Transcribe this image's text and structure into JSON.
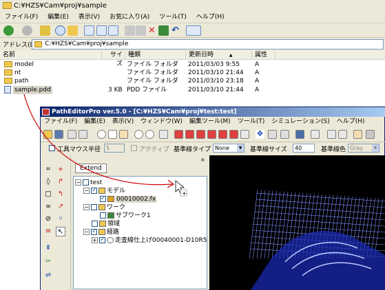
{
  "explorer": {
    "title": "C:¥HZS¥Cam¥proj¥sample",
    "menu": [
      "ファイル(F)",
      "編集(E)",
      "表示(V)",
      "お気に入り(A)",
      "ツール(T)",
      "ヘルプ(H)"
    ],
    "address_label": "アドレス(D)",
    "address_value": "C:¥HZS¥Cam¥proj¥sample",
    "columns": {
      "name": "名前",
      "size": "サイズ",
      "type": "種類",
      "date": "更新日時",
      "sort": "▲",
      "attr": "属性"
    },
    "rows": [
      {
        "name": "model",
        "size": "",
        "type": "ファイル フォルダ",
        "date": "2011/03/03 9:55",
        "attr": "A",
        "icon": "folder-icon"
      },
      {
        "name": "nt",
        "size": "",
        "type": "ファイル フォルダ",
        "date": "2011/03/10 21:44",
        "attr": "A",
        "icon": "folder-icon"
      },
      {
        "name": "path",
        "size": "",
        "type": "ファイル フォルダ",
        "date": "2011/03/10 23:18",
        "attr": "A",
        "icon": "folder-icon"
      },
      {
        "name": "sample.pdd",
        "size": "3 KB",
        "type": "PDD ファイル",
        "date": "2011/03/10 21:44",
        "attr": "A",
        "icon": "file-icon"
      }
    ]
  },
  "editor": {
    "title": "PathEditorPro ver.5.0 - [C:¥HZS¥Cam¥proj¥test:test]",
    "menu": [
      "ファイル(F)",
      "編集(E)",
      "表示(V)",
      "ウィンドウ(W)",
      "編集ツール(M)",
      "ツール(T)",
      "シミュレーション(S)",
      "ヘルプ(H)"
    ],
    "toolbar2": {
      "tool_mouse_radius": "工具マウス半径",
      "tool_mouse_radius_value": "5",
      "active": "アクティブ",
      "base_line_type": "基準線タイプ",
      "base_line_type_value": "None",
      "base_line_size": "基準線サイズ",
      "base_line_size_value": "40",
      "base_line_color": "基準線色",
      "base_line_color_value": "Gray"
    },
    "tree": {
      "tab": "Extend",
      "close": "×",
      "nodes": [
        {
          "label": "test",
          "checked": false
        },
        {
          "label": "モデル",
          "checked": true
        },
        {
          "label": "00010002.fx",
          "checked": true
        },
        {
          "label": "ワーク",
          "checked": false
        },
        {
          "label": "サブワーク1",
          "checked": false
        },
        {
          "label": "領域",
          "checked": false
        },
        {
          "label": "経路",
          "checked": true
        },
        {
          "label": "走査線仕上げ00040001-D10R5",
          "checked": true
        }
      ]
    }
  },
  "colors": {
    "accent": "#0a246a",
    "arrow": "#cc0000",
    "mesh": "#8090ff"
  }
}
